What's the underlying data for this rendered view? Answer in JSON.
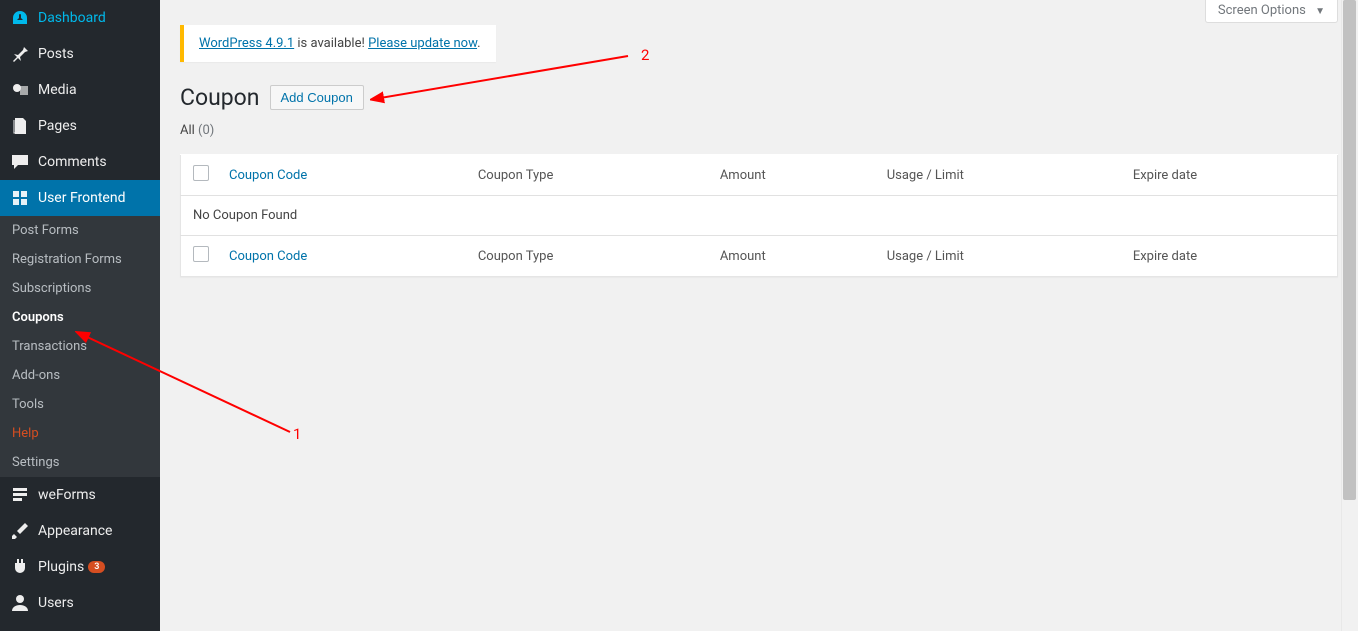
{
  "sidebar": {
    "items": [
      {
        "label": "Dashboard",
        "icon": "gauge"
      },
      {
        "label": "Posts",
        "icon": "pin"
      },
      {
        "label": "Media",
        "icon": "camera"
      },
      {
        "label": "Pages",
        "icon": "pages"
      },
      {
        "label": "Comments",
        "icon": "comment"
      },
      {
        "label": "User Frontend",
        "icon": "uf"
      },
      {
        "label": "weForms",
        "icon": "form"
      },
      {
        "label": "Appearance",
        "icon": "brush"
      },
      {
        "label": "Plugins",
        "icon": "plug",
        "badge": "3"
      },
      {
        "label": "Users",
        "icon": "user"
      }
    ],
    "submenu": {
      "items": [
        {
          "label": "Post Forms"
        },
        {
          "label": "Registration Forms"
        },
        {
          "label": "Subscriptions"
        },
        {
          "label": "Coupons",
          "current": true
        },
        {
          "label": "Transactions"
        },
        {
          "label": "Add-ons"
        },
        {
          "label": "Tools"
        },
        {
          "label": "Help",
          "help": true
        },
        {
          "label": "Settings"
        }
      ]
    }
  },
  "screen_options": {
    "label": "Screen Options"
  },
  "notice": {
    "link1": "WordPress 4.9.1",
    "mid": " is available! ",
    "link2": "Please update now"
  },
  "page": {
    "title": "Coupon",
    "add_btn": "Add Coupon",
    "all_label": "All",
    "all_count": "(0)"
  },
  "table": {
    "headers": {
      "code": "Coupon Code",
      "type": "Coupon Type",
      "amount": "Amount",
      "usage": "Usage / Limit",
      "expire": "Expire date"
    },
    "empty": "No Coupon Found"
  },
  "annotations": {
    "one": "1",
    "two": "2"
  }
}
